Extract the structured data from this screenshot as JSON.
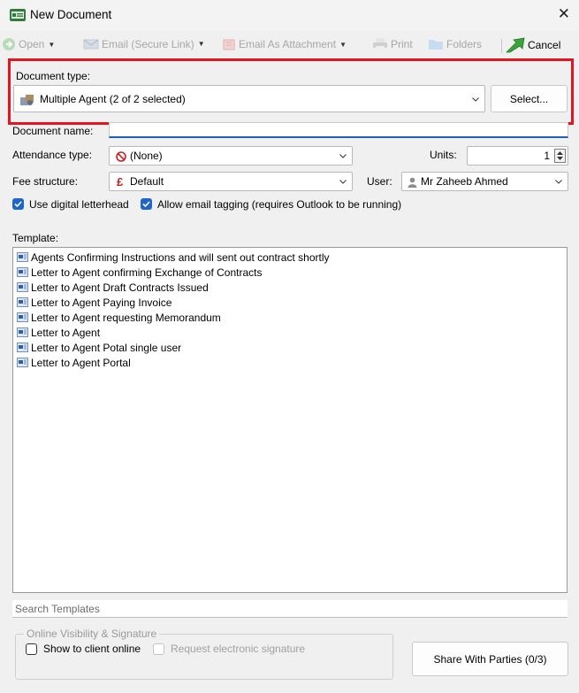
{
  "window": {
    "title": "New Document",
    "close_glyph": "✕"
  },
  "toolbar": {
    "open": "Open",
    "email_secure": "Email (Secure Link)",
    "email_attachment": "Email As Attachment",
    "print": "Print",
    "folders": "Folders",
    "cancel": "Cancel"
  },
  "document_type": {
    "label": "Document type:",
    "value": "Multiple Agent (2 of 2 selected)",
    "select_button": "Select..."
  },
  "document_name": {
    "label": "Document name:",
    "value": ""
  },
  "attendance": {
    "label": "Attendance type:",
    "value": "(None)"
  },
  "units": {
    "label": "Units:",
    "value": "1"
  },
  "fee": {
    "label": "Fee structure:",
    "value": "Default"
  },
  "user": {
    "label": "User:",
    "value": "Mr Zaheeb Ahmed"
  },
  "options": {
    "digital_letterhead": "Use digital letterhead",
    "email_tagging": "Allow email tagging (requires Outlook to be running)"
  },
  "template": {
    "label": "Template:",
    "items": [
      "Agents Confirming Instructions and will sent out contract shortly",
      "Letter to Agent confirming Exchange of Contracts",
      "Letter to Agent Draft Contracts Issued",
      "Letter to Agent Paying Invoice",
      "Letter to Agent requesting Memorandum",
      "Letter to Agent",
      "Letter to Agent Potal single user",
      "Letter to Agent Portal"
    ]
  },
  "search": {
    "placeholder": "Search Templates"
  },
  "online": {
    "group_title": "Online Visibility & Signature",
    "show_online": "Show to client online",
    "request_signature": "Request electronic signature"
  },
  "share_button": "Share With Parties (0/3)",
  "colors": {
    "highlight": "#e5141e",
    "accent": "#1f66c8"
  }
}
